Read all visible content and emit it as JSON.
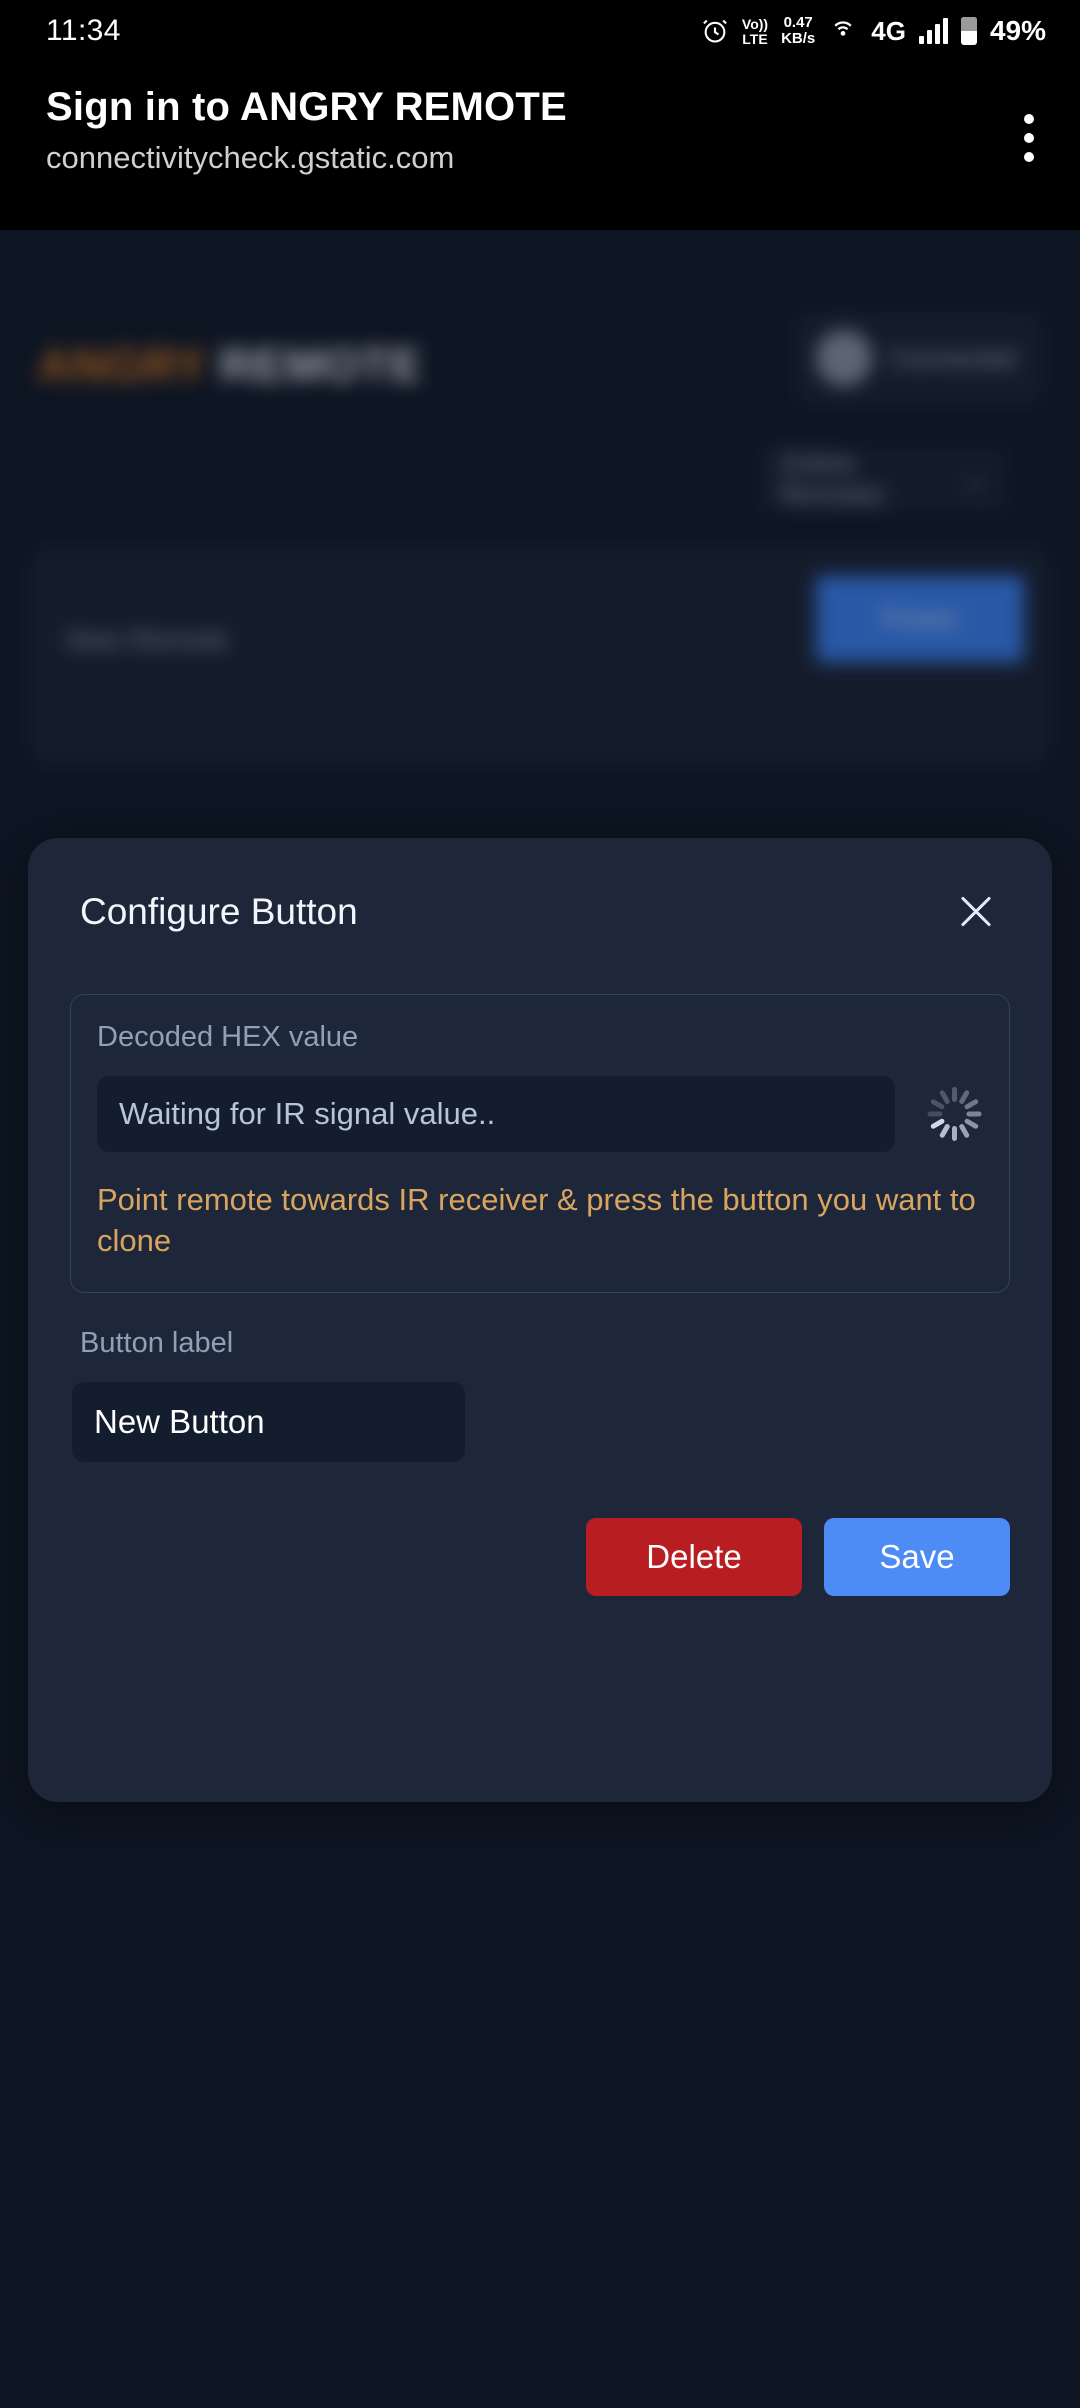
{
  "statusbar": {
    "time": "11:34",
    "volte_top": "Vo))",
    "volte_bottom": "LTE",
    "netspeed_value": "0.47",
    "netspeed_unit": "KB/s",
    "network_type": "4G",
    "battery": "49%",
    "icons": [
      "alarm-icon",
      "volte-icon",
      "network-speed",
      "hotspot-icon",
      "signal-bars-icon",
      "battery-icon"
    ]
  },
  "browser_header": {
    "title": "Sign in to ANGRY REMOTE",
    "url": "connectivitycheck.gstatic.com",
    "menu_icon": "kebab-menu-icon"
  },
  "app_background": {
    "brand_first": "ANGRY",
    "brand_second": "REMOTE",
    "connection_status": "Connected",
    "remotes_dropdown": "Online Remotes",
    "remote_name": "New Remote",
    "power_button": "Power"
  },
  "dialog": {
    "title": "Configure Button",
    "close_icon": "close-icon",
    "hex": {
      "label": "Decoded HEX value",
      "placeholder": "Waiting for IR signal value..",
      "value": "",
      "spinner_icon": "loading-spinner-icon",
      "hint": "Point remote towards IR receiver & press the button you want to clone"
    },
    "button_label": {
      "label": "Button label",
      "value": "New Button"
    },
    "actions": {
      "delete": "Delete",
      "save": "Save"
    }
  },
  "colors": {
    "page_background": "#111a29",
    "dialog_background": "#1d2739",
    "input_background": "#141d2e",
    "accent_blue": "#4d8bf5",
    "danger_red": "#b81d21",
    "hint_orange": "#d9a45f",
    "brand_orange": "#e07c1c"
  }
}
